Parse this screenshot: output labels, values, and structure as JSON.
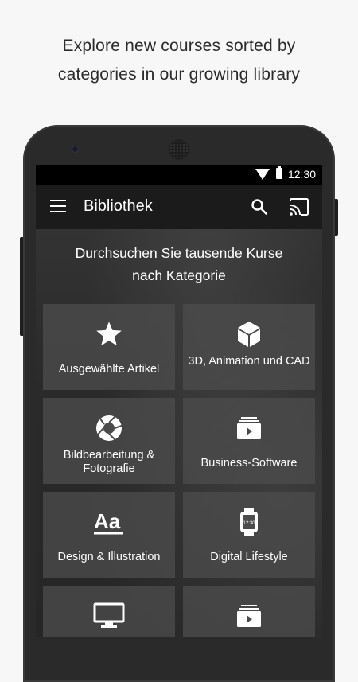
{
  "promo": {
    "line1": "Explore new courses sorted by",
    "line2": "categories in our growing library"
  },
  "status_bar": {
    "time": "12:30",
    "icons": [
      "wifi-icon",
      "battery-icon"
    ]
  },
  "app_bar": {
    "title": "Bibliothek",
    "icons": [
      "menu-icon",
      "search-icon",
      "cast-icon"
    ]
  },
  "main": {
    "headline_line1": "Durchsuchen Sie tausende Kurse",
    "headline_line2": "nach Kategorie",
    "categories": [
      {
        "label": "Ausgewählte Artikel",
        "icon": "star-icon"
      },
      {
        "label": "3D, Animation und CAD",
        "icon": "cube-icon"
      },
      {
        "label": "Bildbearbeitung & Fotografie",
        "icon": "aperture-icon"
      },
      {
        "label": "Business-Software",
        "icon": "video-stack-icon"
      },
      {
        "label": "Design & Illustration",
        "icon": "typography-icon"
      },
      {
        "label": "Digital Lifestyle",
        "icon": "smartwatch-icon"
      },
      {
        "label": "",
        "icon": "monitor-icon"
      },
      {
        "label": "",
        "icon": "video-stack-icon"
      }
    ]
  },
  "colors": {
    "app_bar": "#1b1b1b",
    "status_bar": "#000000",
    "tile": "#4b4b4b"
  }
}
